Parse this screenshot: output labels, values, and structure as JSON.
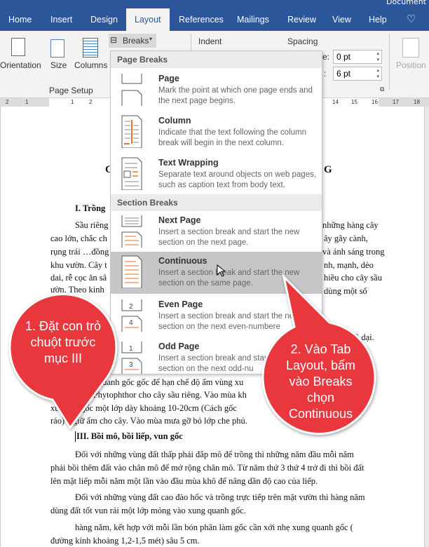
{
  "titlebar": {
    "doc": "Document"
  },
  "tabs": [
    {
      "label": "Home"
    },
    {
      "label": "Insert"
    },
    {
      "label": "Design"
    },
    {
      "label": "Layout",
      "active": true
    },
    {
      "label": "References"
    },
    {
      "label": "Mailings"
    },
    {
      "label": "Review"
    },
    {
      "label": "View"
    },
    {
      "label": "Help"
    },
    {
      "label": "lightbulb-icon"
    }
  ],
  "ribbon": {
    "orientation": "Orientation",
    "size": "Size",
    "columns": "Columns",
    "breaks": "Breaks",
    "group_page_setup": "Page Setup",
    "indent": "Indent",
    "spacing": "Spacing",
    "before_suffix": "e:",
    "after_suffix": ":",
    "spacing_before": "0 pt",
    "spacing_after": "6 pt",
    "position": "Position"
  },
  "ruler": [
    "2",
    "1",
    "1",
    "2",
    "14",
    "15",
    "16",
    "17",
    "18"
  ],
  "menu": {
    "page_breaks": "Page Breaks",
    "section_breaks": "Section Breaks",
    "items": [
      {
        "title": "Page",
        "desc": "Mark the point at which one page ends and the next page begins."
      },
      {
        "title": "Column",
        "desc": "Indicate that the text following the column break will begin in the next column."
      },
      {
        "title": "Text Wrapping",
        "desc": "Separate text around objects on web pages, such as caption text from body text."
      },
      {
        "title": "Next Page",
        "desc": "Insert a section break and start the new section on the next page."
      },
      {
        "title": "Continuous",
        "desc": "Insert a section break and start the new section on the same page.",
        "selected": true
      },
      {
        "title": "Even Page",
        "desc": "Insert a section break and start the new section on the next even-numbere"
      },
      {
        "title": "Odd Page",
        "desc": "Insert a section break and start the new section on the next odd-nu"
      }
    ]
  },
  "callouts": {
    "one": "1. Đặt con trỏ chuột trước mục III",
    "two": "2. Vào Tab Layout, bấm vào Breaks chọn Continuous",
    "color": "#e8373d"
  },
  "document": {
    "title_left": "C",
    "title_right": "G",
    "heading1": "I. Trồng",
    "left_frag": [
      "Sầu riêng",
      "cao lớn, chắc ch",
      "rụng trái …đồng",
      "khu vườn. Cây t",
      "dai, rễ cọc ăn sâ",
      "ườn. Theo kinh"
    ],
    "right_frag": [
      "những hàng cây",
      "ây gãy cành,",
      "và ánh sáng trong",
      "nh, mạnh, dẻo",
      "hiều cho cây sầu",
      "dùng một số",
      "ô dại."
    ],
    "lower_frag": [
      "quanh gốc gốc để hạn chế độ ẩm vùng xu",
      "nấm Phytophthor cho cây sầu riêng. Vào mùa kh",
      "xu     uanh gốc một lớp dày khoảng 10-20cm (Cách gốc",
      "ráo)  ể giữ ẩm cho cây. Vào mùa mưa gỡ bỏ lớp che phủ."
    ],
    "heading3": "III. Bồi mô, bồi liếp, vun gốc",
    "p1": [
      "Đối với những vùng đất thấp phải đắp mô để trồng thì những năm đầu mỗi năm",
      "phải bồi thêm đất vào chân mô để mở rộng chân mô. Từ năm thứ 3 thứ 4 trở đi thì bồi đất",
      "lên mặt liếp mỗi năm một lần vào đầu mùa khô để nâng dần độ cao của liếp."
    ],
    "p2": [
      "Đối với những vùng đất cao đào hốc và trồng trực tiếp trên mặt vườn thì hàng năm",
      "dùng đất tốt vun rải một lớp mỏng vào xung quanh gốc."
    ],
    "p3": [
      "hàng năm, kết hợp với mỗi lần bón phân làm gốc cần xới nhẹ xung quanh gốc (",
      "đường kính khoảng 1,2-1,5 mét) sâu 5 cm."
    ]
  }
}
